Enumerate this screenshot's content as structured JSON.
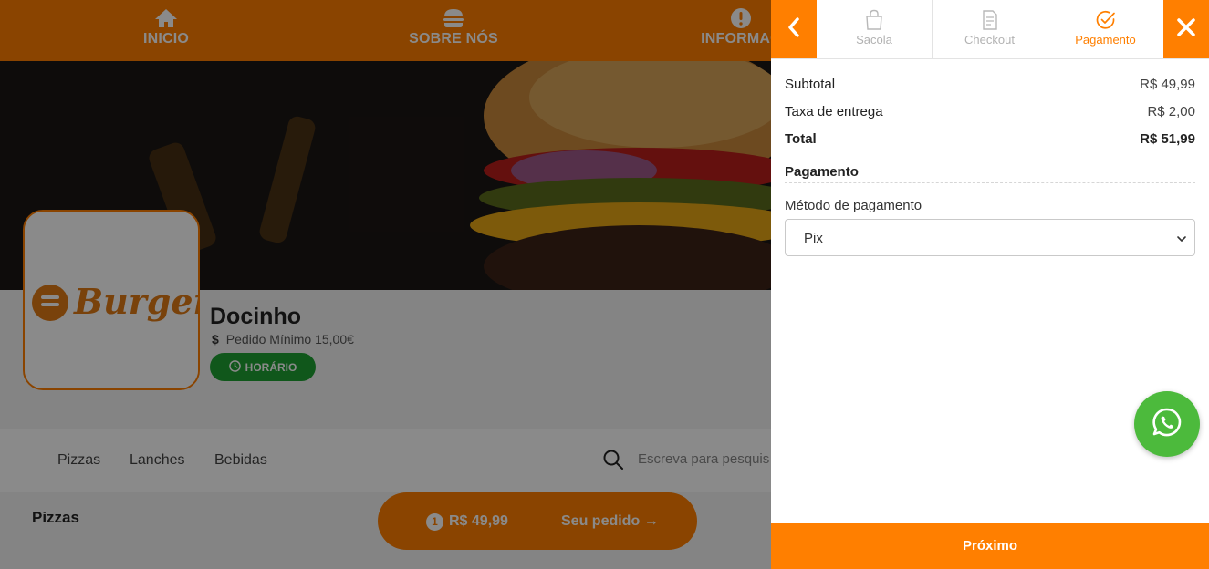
{
  "nav": {
    "items": [
      {
        "label": "INICIO",
        "icon": "home-icon"
      },
      {
        "label": "SOBRE NÓS",
        "icon": "burger-icon"
      },
      {
        "label": "INFORMAÇ",
        "icon": "info-icon"
      }
    ]
  },
  "store": {
    "logo_text": "Burger",
    "name": "Docinho",
    "min_order": "Pedido Mínimo 15,00€",
    "hours_button": "HORÁRIO"
  },
  "categories": [
    "Pizzas",
    "Lanches",
    "Bebidas"
  ],
  "search": {
    "placeholder": "Escreva para pesquis"
  },
  "section_title": "Pizzas",
  "order_pill": {
    "qty": "1",
    "amount": "R$ 49,99",
    "label": "Seu pedido"
  },
  "panel": {
    "steps": [
      {
        "label": "Sacola",
        "icon": "bag-icon",
        "active": false
      },
      {
        "label": "Checkout",
        "icon": "document-icon",
        "active": false
      },
      {
        "label": "Pagamento",
        "icon": "check-circle-icon",
        "active": true
      }
    ],
    "summary": {
      "subtotal_label": "Subtotal",
      "subtotal_value": "R$ 49,99",
      "delivery_label": "Taxa de entrega",
      "delivery_value": "R$ 2,00",
      "total_label": "Total",
      "total_value": "R$ 51,99"
    },
    "payment_title": "Pagamento",
    "method_label": "Método de pagamento",
    "method_selected": "Pix",
    "next_button": "Próximo"
  },
  "colors": {
    "accent": "#ff7f00",
    "success": "#1fa133",
    "whatsapp": "#4cba3c"
  }
}
